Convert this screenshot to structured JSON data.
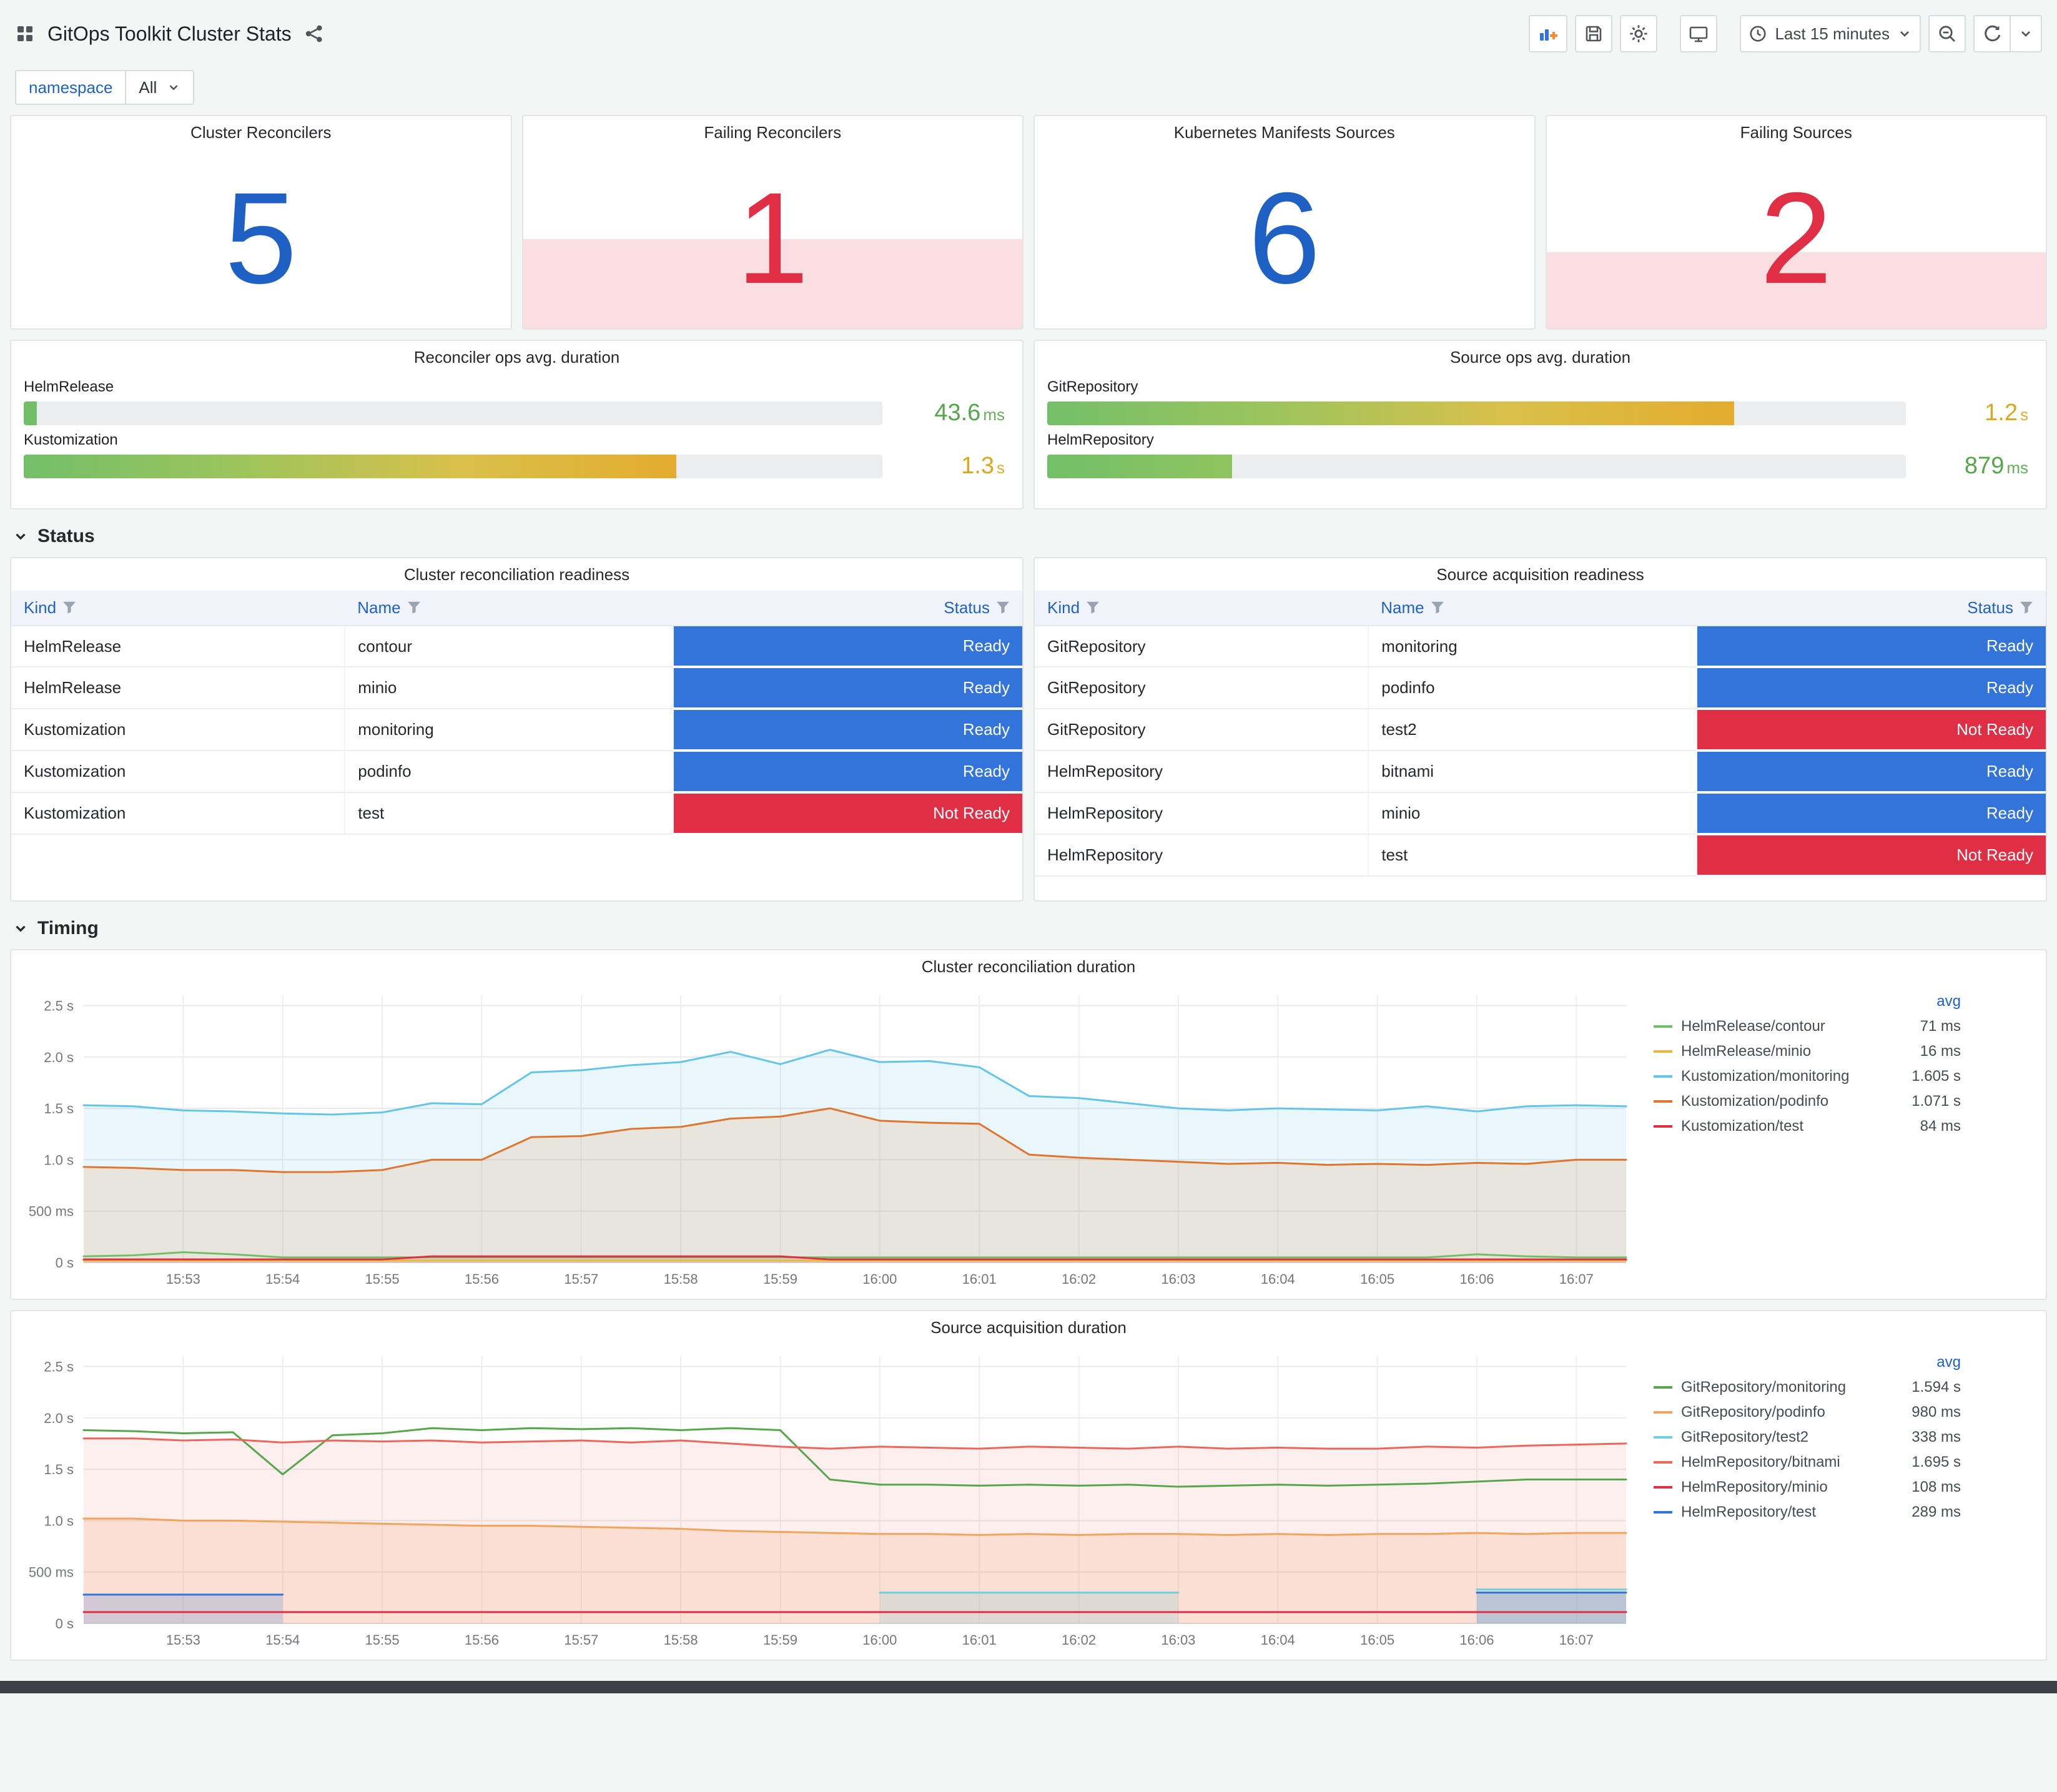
{
  "header": {
    "title": "GitOps Toolkit Cluster Stats",
    "time_range": "Last 15 minutes"
  },
  "variables": {
    "label": "namespace",
    "value": "All"
  },
  "sections": {
    "status": "Status",
    "timing": "Timing"
  },
  "colors": {
    "stat_blue": "#1F60C4",
    "stat_red": "#E02F44",
    "green": "#56A64B",
    "amber": "#D9A81C"
  },
  "status_colors": {
    "Ready": "#3274D9",
    "Not Ready": "#E02F44"
  },
  "stats": [
    {
      "title": "Cluster Reconcilers",
      "value": "5",
      "color": "#1F60C4",
      "fill_height": "0%"
    },
    {
      "title": "Failing Reconcilers",
      "value": "1",
      "color": "#E02F44",
      "fill_height": "42%"
    },
    {
      "title": "Kubernetes Manifests Sources",
      "value": "6",
      "color": "#1F60C4",
      "fill_height": "0%"
    },
    {
      "title": "Failing Sources",
      "value": "2",
      "color": "#E02F44",
      "fill_height": "36%"
    }
  ],
  "gauges": [
    {
      "title": "Reconciler ops avg. duration",
      "bars": [
        {
          "label": "HelmRelease",
          "value": "43.6",
          "unit": "ms",
          "pct": "1.5%",
          "gradient": "linear-gradient(90deg,#73BF69,#73BF69)",
          "value_color": "#56A64B"
        },
        {
          "label": "Kustomization",
          "value": "1.3",
          "unit": "s",
          "pct": "76%",
          "gradient": "linear-gradient(90deg,#73BF69,#9DC45C,#D9C04B,#E3AC2E)",
          "value_color": "#D9A81C"
        }
      ]
    },
    {
      "title": "Source ops avg. duration",
      "bars": [
        {
          "label": "GitRepository",
          "value": "1.2",
          "unit": "s",
          "pct": "80%",
          "gradient": "linear-gradient(90deg,#73BF69,#9DC45C,#D9C04B,#E3AC2E)",
          "value_color": "#D9A81C"
        },
        {
          "label": "HelmRepository",
          "value": "879",
          "unit": "ms",
          "pct": "21.5%",
          "gradient": "linear-gradient(90deg,#73BF69,#8FC45F)",
          "value_color": "#56A64B"
        }
      ]
    }
  ],
  "tables": [
    {
      "title": "Cluster reconciliation readiness",
      "columns": [
        "Kind",
        "Name",
        "Status"
      ],
      "rows": [
        {
          "kind": "HelmRelease",
          "name": "contour",
          "status": "Ready"
        },
        {
          "kind": "HelmRelease",
          "name": "minio",
          "status": "Ready"
        },
        {
          "kind": "Kustomization",
          "name": "monitoring",
          "status": "Ready"
        },
        {
          "kind": "Kustomization",
          "name": "podinfo",
          "status": "Ready"
        },
        {
          "kind": "Kustomization",
          "name": "test",
          "status": "Not Ready"
        }
      ]
    },
    {
      "title": "Source acquisition readiness",
      "columns": [
        "Kind",
        "Name",
        "Status"
      ],
      "rows": [
        {
          "kind": "GitRepository",
          "name": "monitoring",
          "status": "Ready"
        },
        {
          "kind": "GitRepository",
          "name": "podinfo",
          "status": "Ready"
        },
        {
          "kind": "GitRepository",
          "name": "test2",
          "status": "Not Ready"
        },
        {
          "kind": "HelmRepository",
          "name": "bitnami",
          "status": "Ready"
        },
        {
          "kind": "HelmRepository",
          "name": "minio",
          "status": "Ready"
        },
        {
          "kind": "HelmRepository",
          "name": "test",
          "status": "Not Ready"
        }
      ]
    }
  ],
  "chart_data": [
    {
      "type": "line",
      "title": "Cluster reconciliation duration",
      "legend_header": "avg",
      "legend_position": "right",
      "grid": true,
      "ylim": [
        0,
        2.6
      ],
      "yticks": [
        0,
        0.5,
        1.0,
        1.5,
        2.0,
        2.5
      ],
      "ytick_labels": [
        "0 s",
        "500 ms",
        "1.0 s",
        "1.5 s",
        "2.0 s",
        "2.5 s"
      ],
      "x_start": "15:52:00",
      "x_step_seconds": 30,
      "xtick_idx": [
        2,
        4,
        6,
        8,
        10,
        12,
        14,
        16,
        18,
        20,
        22,
        24,
        26,
        28,
        30
      ],
      "xtick_labels": [
        "15:53",
        "15:54",
        "15:55",
        "15:56",
        "15:57",
        "15:58",
        "15:59",
        "16:00",
        "16:01",
        "16:02",
        "16:03",
        "16:04",
        "16:05",
        "16:06",
        "16:07"
      ],
      "series": [
        {
          "name": "HelmRelease/contour",
          "avg": "71 ms",
          "color": "#73BF69",
          "fill": 0,
          "values": [
            0.06,
            0.07,
            0.1,
            0.08,
            0.05,
            0.05,
            0.05,
            0.05,
            0.05,
            0.05,
            0.05,
            0.05,
            0.05,
            0.05,
            0.05,
            0.05,
            0.05,
            0.05,
            0.05,
            0.05,
            0.05,
            0.05,
            0.05,
            0.05,
            0.05,
            0.05,
            0.05,
            0.05,
            0.08,
            0.06,
            0.05,
            0.05
          ]
        },
        {
          "name": "HelmRelease/minio",
          "avg": "16 ms",
          "color": "#EAB839",
          "fill": 0,
          "values": [
            0.02,
            0.02,
            0.02,
            0.02,
            0.02,
            0.02,
            0.02,
            0.02,
            0.02,
            0.02,
            0.02,
            0.02,
            0.02,
            0.02,
            0.02,
            0.02,
            0.02,
            0.02,
            0.02,
            0.02,
            0.02,
            0.02,
            0.02,
            0.02,
            0.02,
            0.02,
            0.02,
            0.02,
            0.02,
            0.02,
            0.02,
            0.02
          ]
        },
        {
          "name": "Kustomization/monitoring",
          "avg": "1.605 s",
          "color": "#64C5E8",
          "fill": 0.14,
          "values": [
            1.53,
            1.52,
            1.48,
            1.47,
            1.45,
            1.44,
            1.46,
            1.55,
            1.54,
            1.85,
            1.87,
            1.92,
            1.95,
            2.05,
            1.93,
            2.07,
            1.95,
            1.96,
            1.9,
            1.62,
            1.6,
            1.55,
            1.5,
            1.48,
            1.5,
            1.49,
            1.48,
            1.52,
            1.47,
            1.52,
            1.53,
            1.52
          ]
        },
        {
          "name": "Kustomization/podinfo",
          "avg": "1.071 s",
          "color": "#E0752D",
          "fill": 0.14,
          "values": [
            0.93,
            0.92,
            0.9,
            0.9,
            0.88,
            0.88,
            0.9,
            1.0,
            1.0,
            1.22,
            1.23,
            1.3,
            1.32,
            1.4,
            1.42,
            1.5,
            1.38,
            1.36,
            1.35,
            1.05,
            1.02,
            1.0,
            0.98,
            0.96,
            0.97,
            0.95,
            0.96,
            0.95,
            0.97,
            0.96,
            1.0,
            1.0
          ]
        },
        {
          "name": "Kustomization/test",
          "avg": "84 ms",
          "color": "#E02F44",
          "fill": 0.12,
          "values": [
            0.03,
            0.03,
            0.03,
            0.03,
            0.03,
            0.03,
            0.03,
            0.06,
            0.06,
            0.06,
            0.06,
            0.06,
            0.06,
            0.06,
            0.06,
            0.03,
            0.03,
            0.03,
            0.03,
            0.03,
            0.03,
            0.03,
            0.03,
            0.03,
            0.03,
            0.03,
            0.03,
            0.03,
            0.03,
            0.03,
            0.03,
            0.03
          ]
        }
      ]
    },
    {
      "type": "line",
      "title": "Source acquisition duration",
      "legend_header": "avg",
      "legend_position": "right",
      "grid": true,
      "ylim": [
        0,
        2.6
      ],
      "yticks": [
        0,
        0.5,
        1.0,
        1.5,
        2.0,
        2.5
      ],
      "ytick_labels": [
        "0 s",
        "500 ms",
        "1.0 s",
        "1.5 s",
        "2.0 s",
        "2.5 s"
      ],
      "x_start": "15:52:00",
      "x_step_seconds": 30,
      "xtick_idx": [
        2,
        4,
        6,
        8,
        10,
        12,
        14,
        16,
        18,
        20,
        22,
        24,
        26,
        28,
        30
      ],
      "xtick_labels": [
        "15:53",
        "15:54",
        "15:55",
        "15:56",
        "15:57",
        "15:58",
        "15:59",
        "16:00",
        "16:01",
        "16:02",
        "16:03",
        "16:04",
        "16:05",
        "16:06",
        "16:07"
      ],
      "series": [
        {
          "name": "GitRepository/monitoring",
          "avg": "1.594 s",
          "color": "#56A64B",
          "fill": 0,
          "values": [
            1.88,
            1.87,
            1.85,
            1.86,
            1.45,
            1.83,
            1.85,
            1.9,
            1.88,
            1.9,
            1.89,
            1.9,
            1.88,
            1.9,
            1.88,
            1.4,
            1.35,
            1.35,
            1.34,
            1.35,
            1.34,
            1.35,
            1.33,
            1.34,
            1.35,
            1.34,
            1.35,
            1.36,
            1.38,
            1.4,
            1.4,
            1.4
          ]
        },
        {
          "name": "GitRepository/podinfo",
          "avg": "980 ms",
          "color": "#F2A35C",
          "fill": 0.18,
          "values": [
            1.02,
            1.02,
            1.0,
            1.0,
            0.99,
            0.98,
            0.97,
            0.96,
            0.95,
            0.95,
            0.94,
            0.93,
            0.92,
            0.9,
            0.89,
            0.88,
            0.87,
            0.87,
            0.86,
            0.87,
            0.86,
            0.87,
            0.87,
            0.86,
            0.87,
            0.86,
            0.87,
            0.87,
            0.88,
            0.87,
            0.88,
            0.88
          ]
        },
        {
          "name": "GitRepository/test2",
          "avg": "338 ms",
          "color": "#6ED0E0",
          "fill": 0.22,
          "values": [
            null,
            null,
            null,
            null,
            null,
            null,
            null,
            null,
            null,
            null,
            null,
            null,
            null,
            null,
            null,
            null,
            0.3,
            0.3,
            0.3,
            0.3,
            0.3,
            0.3,
            0.3,
            null,
            null,
            null,
            null,
            null,
            0.33,
            0.33,
            0.33,
            0.33
          ]
        },
        {
          "name": "HelmRepository/bitnami",
          "avg": "1.695 s",
          "color": "#ED665C",
          "fill": 0.1,
          "values": [
            1.8,
            1.8,
            1.78,
            1.79,
            1.76,
            1.78,
            1.77,
            1.78,
            1.76,
            1.77,
            1.78,
            1.76,
            1.78,
            1.75,
            1.72,
            1.7,
            1.72,
            1.71,
            1.7,
            1.72,
            1.71,
            1.7,
            1.72,
            1.7,
            1.71,
            1.7,
            1.7,
            1.72,
            1.71,
            1.73,
            1.74,
            1.75
          ]
        },
        {
          "name": "HelmRepository/minio",
          "avg": "108 ms",
          "color": "#E02F44",
          "fill": 0,
          "values": [
            0.11,
            0.11,
            0.11,
            0.11,
            0.11,
            0.11,
            0.11,
            0.11,
            0.11,
            0.11,
            0.11,
            0.11,
            0.11,
            0.11,
            0.11,
            0.11,
            0.11,
            0.11,
            0.11,
            0.11,
            0.11,
            0.11,
            0.11,
            0.11,
            0.11,
            0.11,
            0.11,
            0.11,
            0.11,
            0.11,
            0.11,
            0.11
          ]
        },
        {
          "name": "HelmRepository/test",
          "avg": "289 ms",
          "color": "#3274D9",
          "fill": 0.2,
          "values": [
            0.28,
            0.28,
            0.28,
            0.28,
            0.28,
            null,
            null,
            null,
            null,
            null,
            null,
            null,
            null,
            null,
            null,
            null,
            null,
            null,
            null,
            null,
            null,
            null,
            null,
            null,
            null,
            null,
            null,
            null,
            0.3,
            0.3,
            0.3,
            0.3
          ]
        }
      ]
    }
  ]
}
